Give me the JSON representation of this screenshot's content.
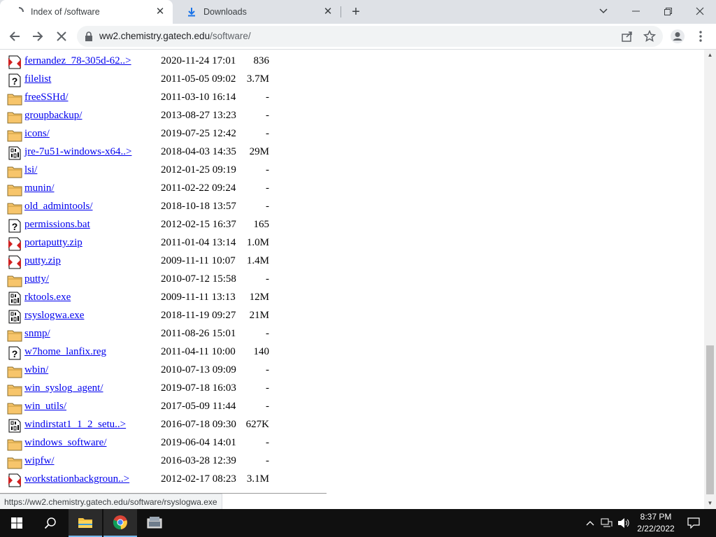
{
  "browser": {
    "tabs": [
      {
        "title": "Index of /software",
        "active": true
      },
      {
        "title": "Downloads",
        "active": false
      }
    ],
    "url_host": "ww2.chemistry.gatech.edu",
    "url_path": "/software/",
    "status_url": "https://ww2.chemistry.gatech.edu/software/rsyslogwa.exe"
  },
  "listing": [
    {
      "name": "fernandez_78-305d-62..>",
      "date": "2020-11-24 17:01",
      "size": "836",
      "icon": "compressed-file-icon"
    },
    {
      "name": "filelist",
      "date": "2011-05-05 09:02",
      "size": "3.7M",
      "icon": "unknown-file-icon"
    },
    {
      "name": "freeSSHd/",
      "date": "2011-03-10 16:14",
      "size": "-",
      "icon": "folder-icon"
    },
    {
      "name": "groupbackup/",
      "date": "2013-08-27 13:23",
      "size": "-",
      "icon": "folder-icon"
    },
    {
      "name": "icons/",
      "date": "2019-07-25 12:42",
      "size": "-",
      "icon": "folder-icon"
    },
    {
      "name": "jre-7u51-windows-x64..>",
      "date": "2018-04-03 14:35",
      "size": "29M",
      "icon": "binary-file-icon"
    },
    {
      "name": "lsi/",
      "date": "2012-01-25 09:19",
      "size": "-",
      "icon": "folder-icon"
    },
    {
      "name": "munin/",
      "date": "2011-02-22 09:24",
      "size": "-",
      "icon": "folder-icon"
    },
    {
      "name": "old_admintools/",
      "date": "2018-10-18 13:57",
      "size": "-",
      "icon": "folder-icon"
    },
    {
      "name": "permissions.bat",
      "date": "2012-02-15 16:37",
      "size": "165",
      "icon": "unknown-file-icon"
    },
    {
      "name": "portaputty.zip",
      "date": "2011-01-04 13:14",
      "size": "1.0M",
      "icon": "compressed-file-icon"
    },
    {
      "name": "putty.zip",
      "date": "2009-11-11 10:07",
      "size": "1.4M",
      "icon": "compressed-file-icon"
    },
    {
      "name": "putty/",
      "date": "2010-07-12 15:58",
      "size": "-",
      "icon": "folder-icon"
    },
    {
      "name": "rktools.exe",
      "date": "2009-11-11 13:13",
      "size": "12M",
      "icon": "binary-file-icon"
    },
    {
      "name": "rsyslogwa.exe",
      "date": "2018-11-19 09:27",
      "size": "21M",
      "icon": "binary-file-icon"
    },
    {
      "name": "snmp/",
      "date": "2011-08-26 15:01",
      "size": "-",
      "icon": "folder-icon"
    },
    {
      "name": "w7home_lanfix.reg",
      "date": "2011-04-11 10:00",
      "size": "140",
      "icon": "unknown-file-icon"
    },
    {
      "name": "wbin/",
      "date": "2010-07-13 09:09",
      "size": "-",
      "icon": "folder-icon"
    },
    {
      "name": "win_syslog_agent/",
      "date": "2019-07-18 16:03",
      "size": "-",
      "icon": "folder-icon"
    },
    {
      "name": "win_utils/",
      "date": "2017-05-09 11:44",
      "size": "-",
      "icon": "folder-icon"
    },
    {
      "name": "windirstat1_1_2_setu..>",
      "date": "2016-07-18 09:30",
      "size": "627K",
      "icon": "binary-file-icon"
    },
    {
      "name": "windows_software/",
      "date": "2019-06-04 14:01",
      "size": "-",
      "icon": "folder-icon"
    },
    {
      "name": "wipfw/",
      "date": "2016-03-28 12:39",
      "size": "-",
      "icon": "folder-icon"
    },
    {
      "name": "workstationbackgroun..>",
      "date": "2012-02-17 08:23",
      "size": "3.1M",
      "icon": "compressed-file-icon"
    }
  ],
  "taskbar": {
    "time": "8:37 PM",
    "date": "2/22/2022"
  }
}
